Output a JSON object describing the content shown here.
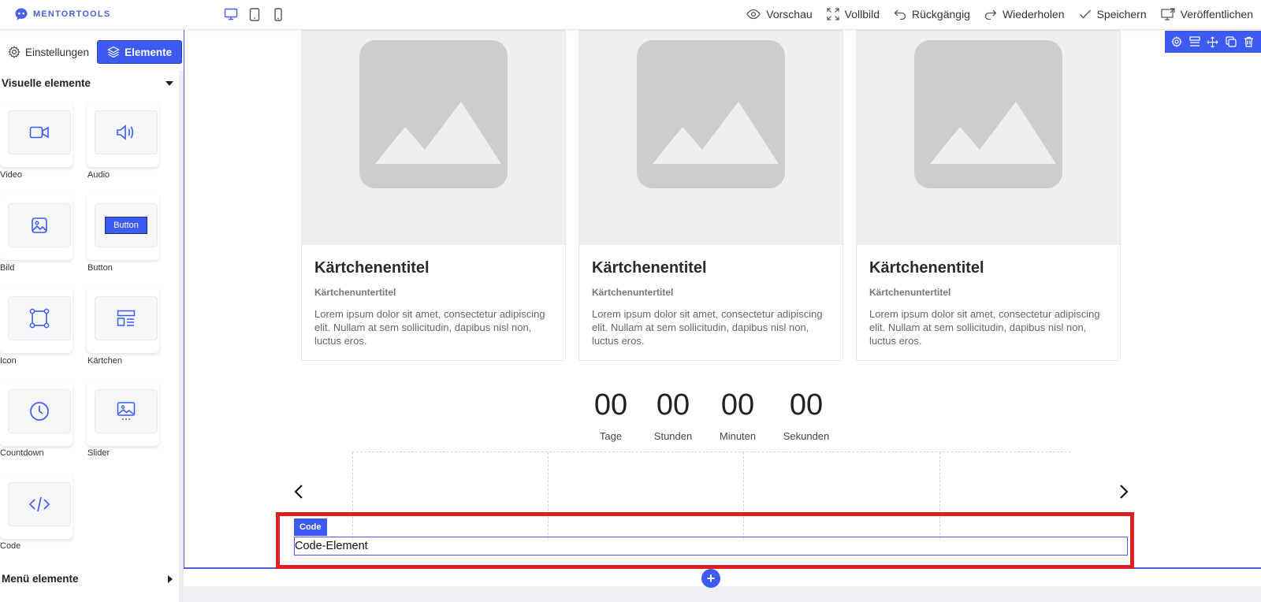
{
  "app": {
    "logo_text": "MENTORTOOLS"
  },
  "topbar": {
    "actions": [
      {
        "label": "Vorschau",
        "icon": "eye-icon"
      },
      {
        "label": "Vollbild",
        "icon": "fullscreen-icon"
      },
      {
        "label": "Rückgängig",
        "icon": "undo-icon"
      },
      {
        "label": "Wiederholen",
        "icon": "redo-icon"
      },
      {
        "label": "Speichern",
        "icon": "check-icon"
      },
      {
        "label": "Veröffentlichen",
        "icon": "publish-icon"
      }
    ],
    "devices": [
      "desktop-icon",
      "tablet-icon",
      "mobile-icon"
    ]
  },
  "sidebar": {
    "tab_settings": "Einstellungen",
    "tab_elements": "Elemente",
    "section_visual": "Visuelle elemente",
    "section_menu": "Menü elemente",
    "tiles": [
      {
        "label": "Video",
        "icon": "video-icon"
      },
      {
        "label": "Audio",
        "icon": "audio-icon"
      },
      {
        "label": "Bild",
        "icon": "image-icon"
      },
      {
        "label": "Button",
        "icon": "button-preview",
        "button_text": "Button"
      },
      {
        "label": "Icon",
        "icon": "icon-shape-icon"
      },
      {
        "label": "Kärtchen",
        "icon": "card-icon"
      },
      {
        "label": "Countdown",
        "icon": "clock-icon"
      },
      {
        "label": "Slider",
        "icon": "slider-icon"
      },
      {
        "label": "Code",
        "icon": "code-icon"
      }
    ]
  },
  "canvas": {
    "cards": [
      {
        "title": "Kärtchenentitel",
        "subtitle": "Kärtchenuntertitel",
        "text": "Lorem ipsum dolor sit amet, consectetur adipiscing elit. Nullam at sem sollicitudin, dapibus nisl non, luctus eros."
      },
      {
        "title": "Kärtchenentitel",
        "subtitle": "Kärtchenuntertitel",
        "text": "Lorem ipsum dolor sit amet, consectetur adipiscing elit. Nullam at sem sollicitudin, dapibus nisl non, luctus eros."
      },
      {
        "title": "Kärtchenentitel",
        "subtitle": "Kärtchenuntertitel",
        "text": "Lorem ipsum dolor sit amet, consectetur adipiscing elit. Nullam at sem sollicitudin, dapibus nisl non, luctus eros."
      }
    ],
    "countdown": [
      {
        "value": "00",
        "label": "Tage"
      },
      {
        "value": "00",
        "label": "Stunden"
      },
      {
        "value": "00",
        "label": "Minuten"
      },
      {
        "value": "00",
        "label": "Sekunden"
      }
    ],
    "code_tag": "Code",
    "code_element_text": "Code-Element",
    "add_label": "+"
  },
  "colors": {
    "accent": "#3d5af1",
    "highlight": "#e02020"
  }
}
